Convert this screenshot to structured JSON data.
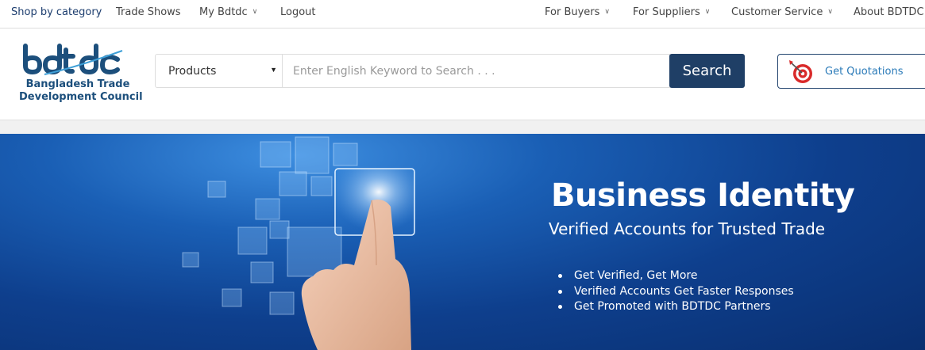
{
  "topnav": {
    "left": [
      {
        "label": "Shop by category",
        "dropdown": false
      },
      {
        "label": "Trade Shows",
        "dropdown": false
      },
      {
        "label": "My Bdtdc",
        "dropdown": true
      },
      {
        "label": "Logout",
        "dropdown": false
      }
    ],
    "right": [
      {
        "label": "For Buyers",
        "dropdown": true
      },
      {
        "label": "For Suppliers",
        "dropdown": true
      },
      {
        "label": "Customer Service",
        "dropdown": true
      },
      {
        "label": "About BDTDC",
        "dropdown": false
      }
    ],
    "caret": "∨"
  },
  "logo": {
    "wordmark": "bdtdc",
    "line1": "Bangladesh Trade",
    "line2": "Development Council"
  },
  "search": {
    "category": "Products",
    "placeholder": "Enter English Keyword to Search . . .",
    "value": "",
    "button_label": "Search"
  },
  "quotation": {
    "label": "Get Quotations",
    "icon": "target-icon"
  },
  "banner": {
    "title": "Business Identity",
    "subtitle": "Verified Accounts for Trusted Trade",
    "bullets": [
      "Get Verified, Get More",
      "Verified Accounts Get Faster Responses",
      "Get Promoted with BDTDC Partners"
    ]
  },
  "colors": {
    "brand_navy": "#1f3f66",
    "logo_blue": "#1c4f7c",
    "link_blue": "#2a7ab8",
    "banner_blue": "#0e3f8d"
  }
}
